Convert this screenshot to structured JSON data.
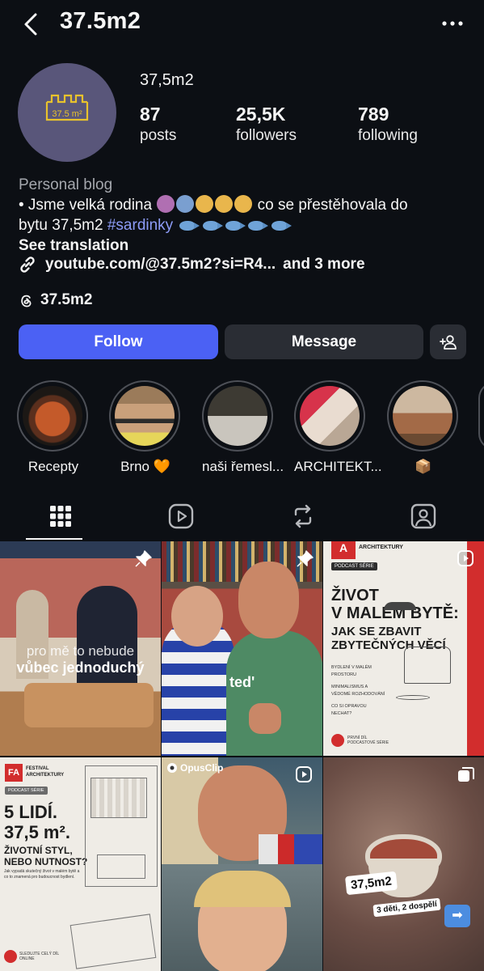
{
  "header": {
    "title": "37.5m2"
  },
  "profile": {
    "display_name": "37,5m2",
    "logo_text": "37.5 m²",
    "stats": [
      {
        "value": "87",
        "label": "posts"
      },
      {
        "value": "25,5K",
        "label": "followers"
      },
      {
        "value": "789",
        "label": "following"
      }
    ]
  },
  "bio": {
    "category": "Personal blog",
    "line1_prefix": "• Jsme velká rodina",
    "line1_suffix": "co se přestěhovala do",
    "line2_prefix": "bytu 37,5m2",
    "hashtag": "#sardinky",
    "see_translation": "See translation",
    "link": "youtube.com/@37.5m2?si=R4...",
    "link_more": "and 3 more",
    "threads_handle": "37.5m2"
  },
  "buttons": {
    "follow": "Follow",
    "message": "Message"
  },
  "highlights": [
    {
      "label": "Recepty"
    },
    {
      "label": "Brno 🧡"
    },
    {
      "label": "naši řemesl..."
    },
    {
      "label": "ARCHITEKT..."
    },
    {
      "label": "📦"
    }
  ],
  "grid": {
    "post1": {
      "line1": "pro mě to nebude",
      "line2": "vůbec jednoduchý"
    },
    "post2": {
      "caption": "ted'"
    },
    "post3": {
      "brand": "ARCHITEKTURY",
      "tag": "PODCAST SÉRIE",
      "title1": "ŽIVOT",
      "title2": "V MALÉM BYTĚ:",
      "title3": "JAK SE ZBAVIT",
      "title4": "ZBYTEČNÝCH VĚCÍ",
      "items": [
        "BYDLENÍ V MALÉM PROSTORU",
        "MINIMALISMUS A VĚDOMÉ ROZHODOVÁNÍ",
        "CO SI OPRAVOU NECHAT?"
      ],
      "footer": "PRVNÍ DÍL PODCASTOVÉ SÉRIE"
    },
    "post4": {
      "brand1": "FESTIVAL",
      "brand2": "ARCHITEKTURY",
      "tag": "PODCAST SÉRIE",
      "title1": "5 LIDÍ.",
      "title2": "37,5 m².",
      "title3": "ŽIVOTNÍ STYL,",
      "title4": "NEBO NUTNOST?",
      "desc": "Jak vypadá skutečný život v malém bytě a co to znamená pro budoucnost bydlení.",
      "footer": "SLEDUJTE CELÝ DÍL ONLINE"
    },
    "post5": {
      "badge": "OpusClip"
    },
    "post6": {
      "sticker1": "37,5m2",
      "sticker2": "3 děti, 2 dospělí"
    }
  },
  "colors": {
    "accent": "#4b61f4",
    "background": "#0c0f14",
    "hashtag": "#8d9cf7",
    "logo_yellow": "#e8c22c",
    "festival_red": "#d22d2d"
  },
  "icons": {
    "back": "chevron-left-icon",
    "more": "more-horizontal-icon",
    "link": "link-icon",
    "threads": "threads-icon",
    "add_user": "add-user-icon",
    "tabs": [
      "grid-icon",
      "reels-icon",
      "reposts-icon",
      "tagged-icon"
    ]
  }
}
